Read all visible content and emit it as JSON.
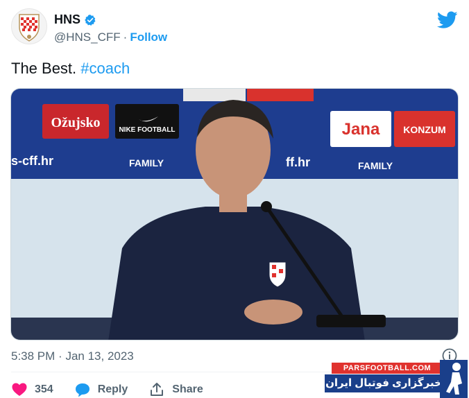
{
  "account": {
    "name": "HNS",
    "handle": "@HNS_CFF",
    "separator": "·",
    "follow_label": "Follow",
    "verified_color": "#1d9bf0"
  },
  "tweet": {
    "text": "The Best.",
    "hashtag": "#coach"
  },
  "photo": {
    "sponsor_boards": [
      "Ožujsko",
      "NIKE FOOTBALL",
      "Jana",
      "KONZUM",
      "FAMILY",
      "s-cff.hr",
      "ff.hr"
    ]
  },
  "meta": {
    "time": "5:38 PM",
    "separator": "·",
    "date": "Jan 13, 2023"
  },
  "actions": {
    "like_count": "354",
    "reply_label": "Reply",
    "share_label": "Share"
  },
  "watermark": {
    "site": "PARSFOOTBALL.COM",
    "tagline": "خبرگزاری فوتبال ایران"
  },
  "colors": {
    "link": "#1d9bf0",
    "secondary_text": "#536471",
    "like": "#f91880",
    "twitter": "#1d9bf0"
  },
  "icons": [
    "hns-crest-icon",
    "verified-badge-icon",
    "twitter-bird-icon",
    "info-icon",
    "heart-icon",
    "reply-bubble-icon",
    "share-icon"
  ]
}
